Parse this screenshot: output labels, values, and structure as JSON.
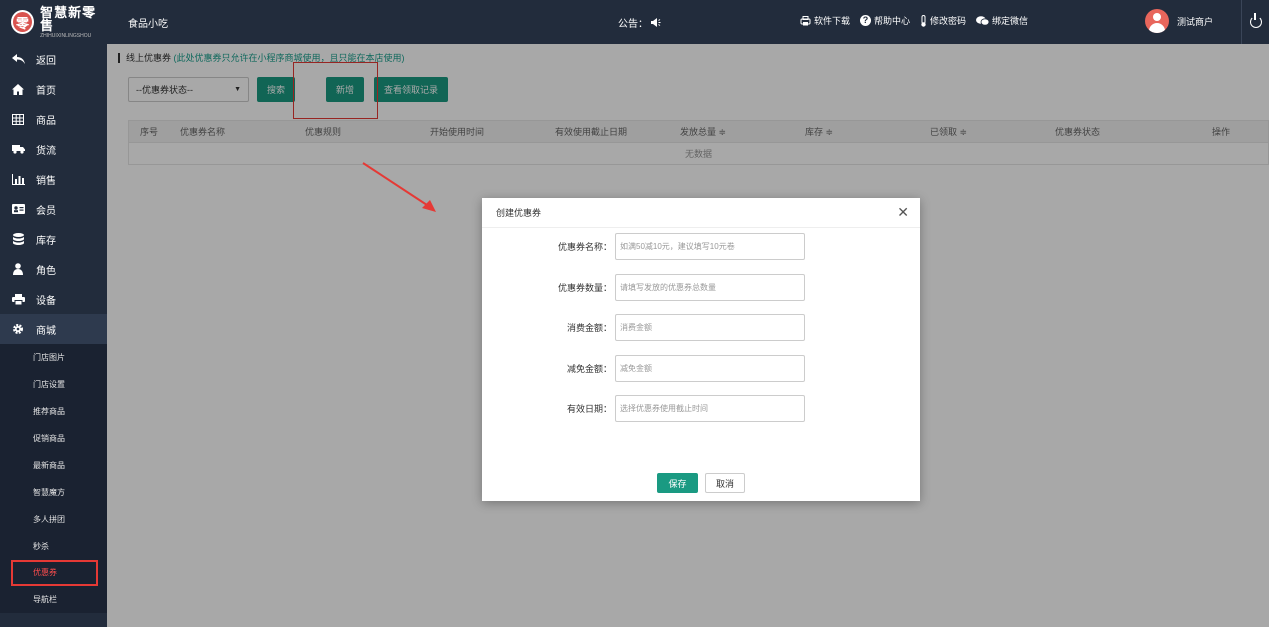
{
  "brand": {
    "logo_char": "零",
    "name": "智慧新零售",
    "tagline": "ZHIHUIXINLINGSHOU"
  },
  "header": {
    "store_name": "食品小吃",
    "notice_label": "公告：",
    "links": [
      {
        "label": "软件下载",
        "icon": "download-icon"
      },
      {
        "label": "帮助中心",
        "icon": "help-icon"
      },
      {
        "label": "修改密码",
        "icon": "thermometer-icon"
      },
      {
        "label": "绑定微信",
        "icon": "wechat-icon"
      }
    ],
    "user_name": "测试商户"
  },
  "sidebar": {
    "items": [
      {
        "label": "返回",
        "icon": "back-icon"
      },
      {
        "label": "首页",
        "icon": "home-icon"
      },
      {
        "label": "商品",
        "icon": "grid-icon"
      },
      {
        "label": "货流",
        "icon": "truck-icon"
      },
      {
        "label": "销售",
        "icon": "bar-chart-icon"
      },
      {
        "label": "会员",
        "icon": "id-card-icon"
      },
      {
        "label": "库存",
        "icon": "database-icon"
      },
      {
        "label": "角色",
        "icon": "user-icon"
      },
      {
        "label": "设备",
        "icon": "printer-icon"
      },
      {
        "label": "商城",
        "icon": "gear-icon"
      }
    ],
    "submenu": [
      "门店图片",
      "门店设置",
      "推荐商品",
      "促销商品",
      "最新商品",
      "智慧魔方",
      "多人拼团",
      "秒杀",
      "优惠券",
      "导航栏"
    ]
  },
  "page": {
    "title": "线上优惠券",
    "hint": "(此处优惠券只允许在小程序商城使用，且只能在本店使用)",
    "status_select": "--优惠券状态--",
    "search_btn": "搜索",
    "add_btn": "新增",
    "records_btn": "查看领取记录",
    "columns": [
      "序号",
      "优惠券名称",
      "优惠规则",
      "开始使用时间",
      "有效使用截止日期",
      "发放总量 ≑",
      "库存 ≑",
      "已领取 ≑",
      "优惠券状态",
      "操作"
    ],
    "empty": "无数据"
  },
  "dialog": {
    "title": "创建优惠券",
    "fields": [
      {
        "label": "优惠券名称：",
        "placeholder": "如满50减10元，建议填写10元卷"
      },
      {
        "label": "优惠券数量：",
        "placeholder": "请填写发放的优惠券总数量"
      },
      {
        "label": "消费金额：",
        "placeholder": "消费金额"
      },
      {
        "label": "减免金额：",
        "placeholder": "减免金额"
      },
      {
        "label": "有效日期：",
        "placeholder": "选择优惠券使用截止时间"
      }
    ],
    "save": "保存",
    "cancel": "取消"
  },
  "colors": {
    "sidebar_bg": "#222c3c",
    "accent": "#1a9a82",
    "highlight": "#e53935",
    "hint": "#1aa08e"
  }
}
